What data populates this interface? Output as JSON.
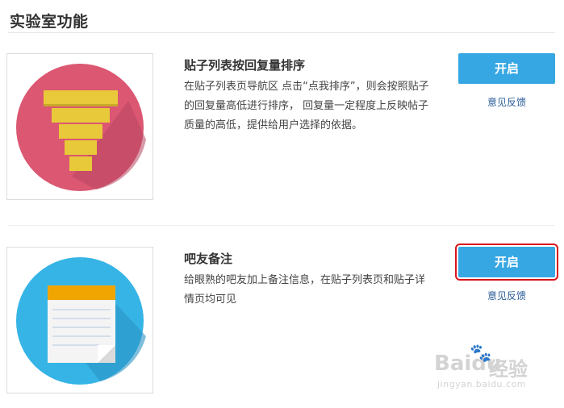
{
  "section": {
    "title": "实验室功能"
  },
  "features": [
    {
      "title": "贴子列表按回复量排序",
      "description": "在贴子列表页导航区 点击“点我排序”，则会按照贴子的回复量高低进行排序， 回复量一定程度上反映帖子质量的高低，提供给用户选择的依据。",
      "button_label": "开启",
      "feedback_label": "意见反馈",
      "icon": "funnel-sort-icon"
    },
    {
      "title": "吧友备注",
      "description": "给眼熟的吧友加上备注信息，在贴子列表页和贴子详情页均可见",
      "button_label": "开启",
      "feedback_label": "意见反馈",
      "icon": "notepad-icon"
    }
  ],
  "watermark": {
    "brand": "Bai",
    "brand_suffix": "du",
    "cn": "经验",
    "url": "jingyan.baidu.com"
  },
  "colors": {
    "button": "#36a7e3",
    "highlight": "#d8141c",
    "link": "#2a5c98",
    "funnel_circle": "#db5772",
    "funnel": "#e8c93a",
    "notepad_circle": "#36b4e6",
    "notepad_header": "#f0a500"
  }
}
